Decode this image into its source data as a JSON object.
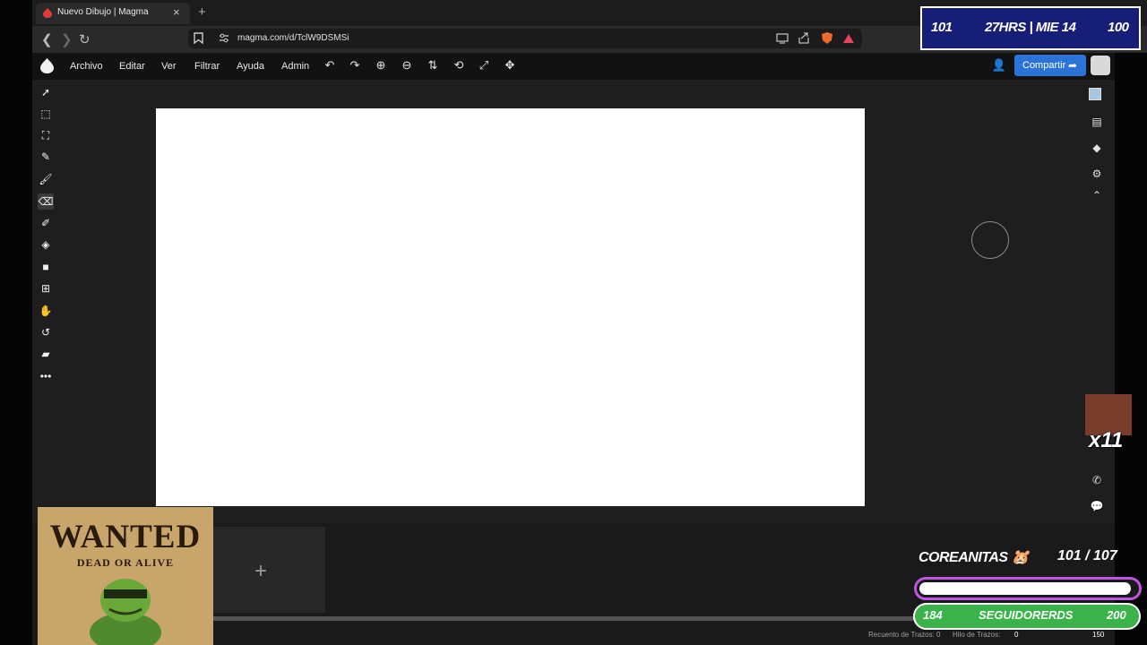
{
  "browser": {
    "tab_title": "Nuevo Dibujo | Magma",
    "tab_close": "×",
    "new_tab": "+",
    "url": "magma.com/d/TclW9DSMSi"
  },
  "app": {
    "menu": [
      "Archivo",
      "Editar",
      "Ver",
      "Filtrar",
      "Ayuda",
      "Admin"
    ],
    "share_label": "Compartir"
  },
  "bottom": {
    "add_frame": "+",
    "stroke_count_label": "Recuento de Trazos: 0",
    "stroke_thread_label": "Hilo de Trazos:",
    "stroke_thread_value": "0",
    "zoom_value": "150"
  },
  "overlay": {
    "left_value": "101",
    "center": "27HRS | MIE 14",
    "right_value": "100"
  },
  "wanted": {
    "title": "WANTED",
    "subtitle": "DEAD OR ALIVE"
  },
  "emote": {
    "count": "x11"
  },
  "goal": {
    "label": "COREANITAS 🐹",
    "count": "101  / 107",
    "follow_left": "184",
    "follow_label": "SEGUIDORERDS",
    "follow_right": "200"
  },
  "colors": {
    "share_button": "#2b73d6",
    "overlay_box": "#171e78",
    "goal_border": "#c155e0",
    "follow_bar": "#3ab34a"
  }
}
